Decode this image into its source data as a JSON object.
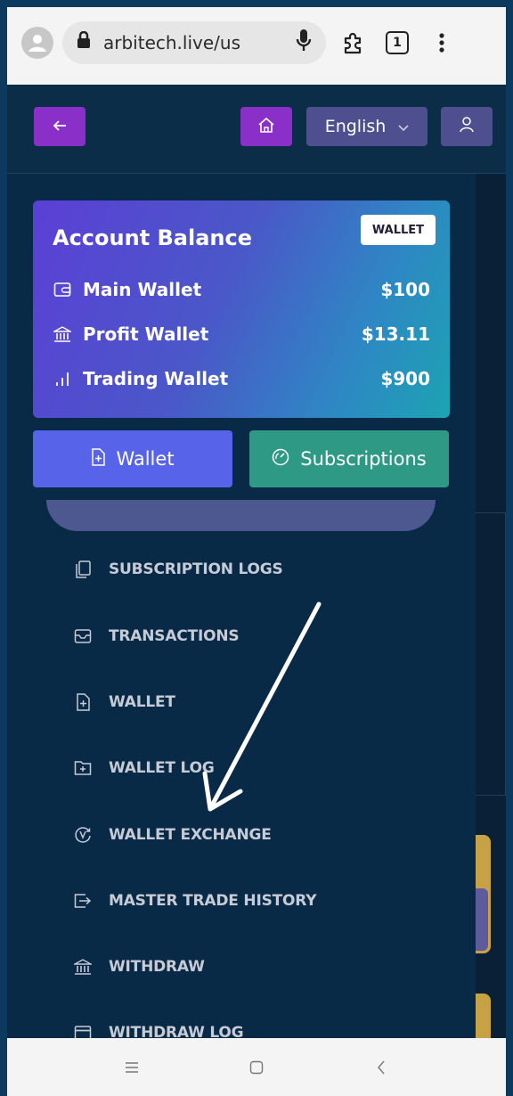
{
  "browser": {
    "url": "arbitech.live/us",
    "tab_count": "1",
    "icons": [
      "account-icon",
      "lock-icon",
      "mic-icon",
      "extensions-icon",
      "tabs-icon",
      "menu-icon"
    ]
  },
  "header": {
    "language": "English",
    "icons": [
      "back-arrow-icon",
      "home-icon",
      "chevron-down-icon",
      "user-icon"
    ]
  },
  "balance": {
    "title": "Account Balance",
    "badge": "WALLET",
    "rows": [
      {
        "label": "Main Wallet",
        "value": "$100",
        "icon": "wallet-icon"
      },
      {
        "label": "Profit Wallet",
        "value": "$13.11",
        "icon": "bank-icon"
      },
      {
        "label": "Trading Wallet",
        "value": "$900",
        "icon": "bar-chart-icon"
      }
    ]
  },
  "actions": {
    "wallet_label": "Wallet",
    "subscriptions_label": "Subscriptions"
  },
  "menu": {
    "items": [
      {
        "label": "SUBSCRIPTION LOGS",
        "icon": "copy-icon"
      },
      {
        "label": "TRANSACTIONS",
        "icon": "inbox-icon"
      },
      {
        "label": "WALLET",
        "icon": "file-plus-icon"
      },
      {
        "label": "WALLET LOG",
        "icon": "folder-plus-icon"
      },
      {
        "label": "WALLET EXCHANGE",
        "icon": "exchange-icon"
      },
      {
        "label": "MASTER TRADE HISTORY",
        "icon": "history-icon"
      },
      {
        "label": "WITHDRAW",
        "icon": "bank-icon"
      },
      {
        "label": "WITHDRAW LOG",
        "icon": "wallet-card-icon"
      }
    ]
  },
  "colors": {
    "sidebar": "#082a47",
    "purple_button": "#8b2fc9",
    "indigo_button": "#4e4f8e",
    "wallet_button": "#5764ea",
    "subscriptions_button": "#2e9a86"
  }
}
